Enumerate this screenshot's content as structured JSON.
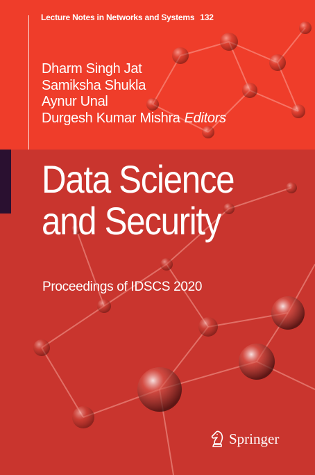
{
  "series": {
    "name": "Lecture Notes in Networks and Systems",
    "number": "132"
  },
  "editors": {
    "names": [
      "Dharm Singh Jat",
      "Samiksha Shukla",
      "Aynur Unal",
      "Durgesh Kumar Mishra"
    ],
    "role": "Editors"
  },
  "title": {
    "line1": "Data Science",
    "line2": "and Security"
  },
  "subtitle": "Proceedings of IDSCS 2020",
  "publisher": {
    "name": "Springer",
    "icon": "springer-chess-knight-icon"
  },
  "colors": {
    "cover_red": "#ef3d2a",
    "band_red": "#c9352e",
    "accent_dark": "#2a1030",
    "text": "#ffffff"
  }
}
